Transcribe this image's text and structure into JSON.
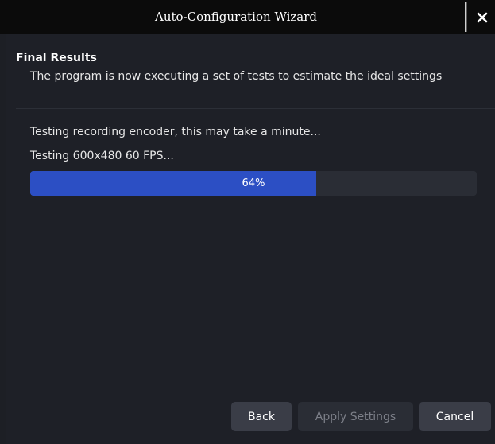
{
  "window": {
    "title": "Auto-Configuration Wizard",
    "close_icon": "close-icon"
  },
  "section": {
    "title": "Final Results",
    "description": "The program is now executing a set of tests to estimate the ideal settings"
  },
  "status": {
    "line1": "Testing recording encoder, this may take a minute...",
    "line2": "Testing 600x480 60 FPS..."
  },
  "progress": {
    "value": 64,
    "label": "64%"
  },
  "buttons": {
    "back": "Back",
    "apply": "Apply Settings",
    "cancel": "Cancel"
  },
  "colors": {
    "progress_fill": "#2c4fc4",
    "background": "#1e2027"
  }
}
